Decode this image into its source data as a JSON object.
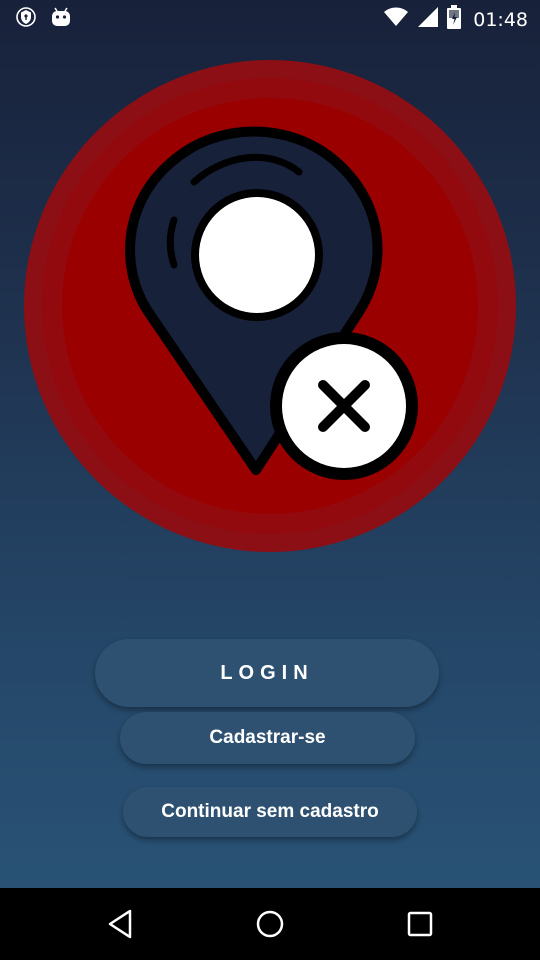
{
  "status_bar": {
    "time": "01:48",
    "left_icons": [
      "shield-icon",
      "android-icon"
    ],
    "right_icons": [
      "wifi-icon",
      "signal-icon",
      "battery-icon"
    ]
  },
  "logo": {
    "icon": "map-pin-cancel-icon",
    "outer_color": "#8f0d12",
    "inner_color": "#9b0000",
    "pin_color": "#18213a"
  },
  "buttons": {
    "login_label": "LOGIN",
    "register_label": "Cadastrar-se",
    "guest_label": "Continuar sem cadastro"
  },
  "nav_bar": {
    "icons": [
      "back-icon",
      "home-icon",
      "recents-icon"
    ]
  },
  "colors": {
    "background_top": "#18213a",
    "background_bottom": "#2a5679",
    "button": "#2e5171",
    "text": "#ffffff"
  }
}
